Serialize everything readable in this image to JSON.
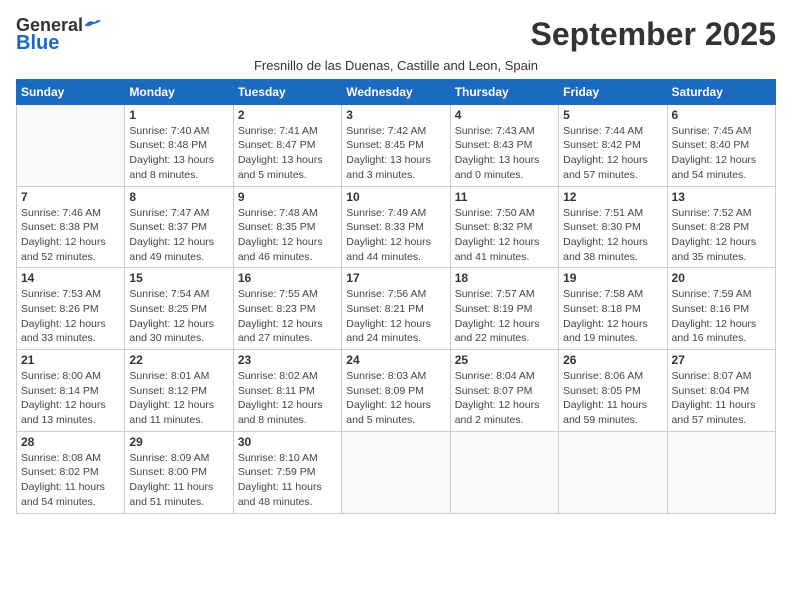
{
  "header": {
    "logo": {
      "general": "General",
      "blue": "Blue"
    },
    "title": "September 2025",
    "subtitle": "Fresnillo de las Duenas, Castille and Leon, Spain"
  },
  "days_of_week": [
    "Sunday",
    "Monday",
    "Tuesday",
    "Wednesday",
    "Thursday",
    "Friday",
    "Saturday"
  ],
  "weeks": [
    [
      {
        "day": "",
        "info": ""
      },
      {
        "day": "1",
        "info": "Sunrise: 7:40 AM\nSunset: 8:48 PM\nDaylight: 13 hours\nand 8 minutes."
      },
      {
        "day": "2",
        "info": "Sunrise: 7:41 AM\nSunset: 8:47 PM\nDaylight: 13 hours\nand 5 minutes."
      },
      {
        "day": "3",
        "info": "Sunrise: 7:42 AM\nSunset: 8:45 PM\nDaylight: 13 hours\nand 3 minutes."
      },
      {
        "day": "4",
        "info": "Sunrise: 7:43 AM\nSunset: 8:43 PM\nDaylight: 13 hours\nand 0 minutes."
      },
      {
        "day": "5",
        "info": "Sunrise: 7:44 AM\nSunset: 8:42 PM\nDaylight: 12 hours\nand 57 minutes."
      },
      {
        "day": "6",
        "info": "Sunrise: 7:45 AM\nSunset: 8:40 PM\nDaylight: 12 hours\nand 54 minutes."
      }
    ],
    [
      {
        "day": "7",
        "info": "Sunrise: 7:46 AM\nSunset: 8:38 PM\nDaylight: 12 hours\nand 52 minutes."
      },
      {
        "day": "8",
        "info": "Sunrise: 7:47 AM\nSunset: 8:37 PM\nDaylight: 12 hours\nand 49 minutes."
      },
      {
        "day": "9",
        "info": "Sunrise: 7:48 AM\nSunset: 8:35 PM\nDaylight: 12 hours\nand 46 minutes."
      },
      {
        "day": "10",
        "info": "Sunrise: 7:49 AM\nSunset: 8:33 PM\nDaylight: 12 hours\nand 44 minutes."
      },
      {
        "day": "11",
        "info": "Sunrise: 7:50 AM\nSunset: 8:32 PM\nDaylight: 12 hours\nand 41 minutes."
      },
      {
        "day": "12",
        "info": "Sunrise: 7:51 AM\nSunset: 8:30 PM\nDaylight: 12 hours\nand 38 minutes."
      },
      {
        "day": "13",
        "info": "Sunrise: 7:52 AM\nSunset: 8:28 PM\nDaylight: 12 hours\nand 35 minutes."
      }
    ],
    [
      {
        "day": "14",
        "info": "Sunrise: 7:53 AM\nSunset: 8:26 PM\nDaylight: 12 hours\nand 33 minutes."
      },
      {
        "day": "15",
        "info": "Sunrise: 7:54 AM\nSunset: 8:25 PM\nDaylight: 12 hours\nand 30 minutes."
      },
      {
        "day": "16",
        "info": "Sunrise: 7:55 AM\nSunset: 8:23 PM\nDaylight: 12 hours\nand 27 minutes."
      },
      {
        "day": "17",
        "info": "Sunrise: 7:56 AM\nSunset: 8:21 PM\nDaylight: 12 hours\nand 24 minutes."
      },
      {
        "day": "18",
        "info": "Sunrise: 7:57 AM\nSunset: 8:19 PM\nDaylight: 12 hours\nand 22 minutes."
      },
      {
        "day": "19",
        "info": "Sunrise: 7:58 AM\nSunset: 8:18 PM\nDaylight: 12 hours\nand 19 minutes."
      },
      {
        "day": "20",
        "info": "Sunrise: 7:59 AM\nSunset: 8:16 PM\nDaylight: 12 hours\nand 16 minutes."
      }
    ],
    [
      {
        "day": "21",
        "info": "Sunrise: 8:00 AM\nSunset: 8:14 PM\nDaylight: 12 hours\nand 13 minutes."
      },
      {
        "day": "22",
        "info": "Sunrise: 8:01 AM\nSunset: 8:12 PM\nDaylight: 12 hours\nand 11 minutes."
      },
      {
        "day": "23",
        "info": "Sunrise: 8:02 AM\nSunset: 8:11 PM\nDaylight: 12 hours\nand 8 minutes."
      },
      {
        "day": "24",
        "info": "Sunrise: 8:03 AM\nSunset: 8:09 PM\nDaylight: 12 hours\nand 5 minutes."
      },
      {
        "day": "25",
        "info": "Sunrise: 8:04 AM\nSunset: 8:07 PM\nDaylight: 12 hours\nand 2 minutes."
      },
      {
        "day": "26",
        "info": "Sunrise: 8:06 AM\nSunset: 8:05 PM\nDaylight: 11 hours\nand 59 minutes."
      },
      {
        "day": "27",
        "info": "Sunrise: 8:07 AM\nSunset: 8:04 PM\nDaylight: 11 hours\nand 57 minutes."
      }
    ],
    [
      {
        "day": "28",
        "info": "Sunrise: 8:08 AM\nSunset: 8:02 PM\nDaylight: 11 hours\nand 54 minutes."
      },
      {
        "day": "29",
        "info": "Sunrise: 8:09 AM\nSunset: 8:00 PM\nDaylight: 11 hours\nand 51 minutes."
      },
      {
        "day": "30",
        "info": "Sunrise: 8:10 AM\nSunset: 7:59 PM\nDaylight: 11 hours\nand 48 minutes."
      },
      {
        "day": "",
        "info": ""
      },
      {
        "day": "",
        "info": ""
      },
      {
        "day": "",
        "info": ""
      },
      {
        "day": "",
        "info": ""
      }
    ]
  ]
}
